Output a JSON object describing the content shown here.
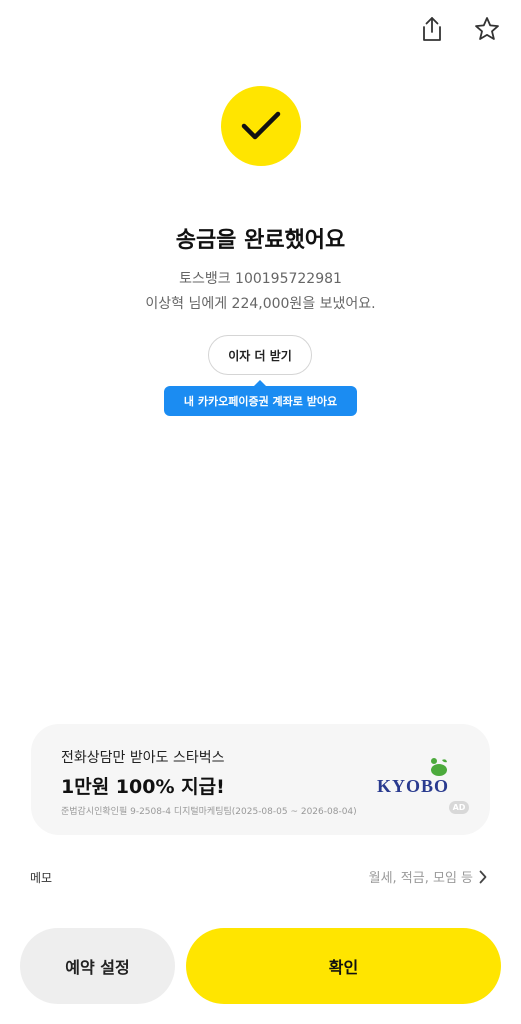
{
  "header": {
    "share_icon": "share-icon",
    "star_icon": "star-outline-icon"
  },
  "status": {
    "icon": "check-icon",
    "title": "송금을 완료했어요",
    "bank_line": "토스뱅크 100195722981",
    "sent_line": "이상혁 님에게 224,000원을 보냈어요."
  },
  "interest": {
    "button_label": "이자 더 받기",
    "tooltip": "내 카카오페이증권 계좌로 받아요"
  },
  "ad": {
    "line1": "전화상담만 받아도 스타벅스",
    "line2": "1만원 100% 지급!",
    "fine_print": "준법감시인확인필 9-2508-4 디지털마케팅팀(2025-08-05 ~ 2026-08-04)",
    "brand": "KYOBO",
    "badge": "AD"
  },
  "memo": {
    "label": "메모",
    "placeholder": "월세, 적금, 모임 등"
  },
  "actions": {
    "reserve_label": "예약 설정",
    "confirm_label": "확인"
  },
  "colors": {
    "accent_yellow": "#ffe500",
    "tooltip_blue": "#1b8cf2",
    "brand_navy": "#2a3b8f",
    "brand_green": "#4caa3c"
  }
}
